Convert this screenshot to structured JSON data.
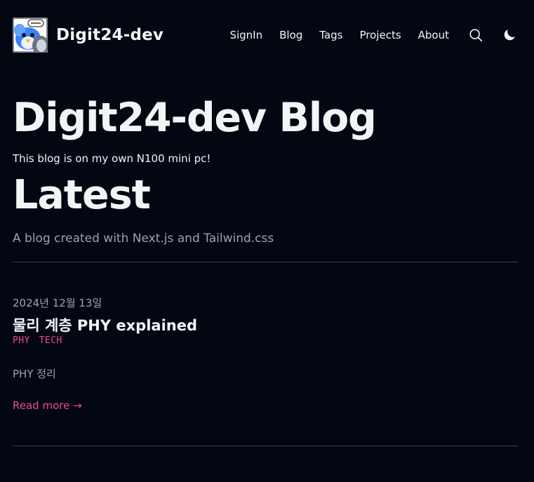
{
  "header": {
    "site_title": "Digit24-dev",
    "logo_icon": "penguin-mascot-logo",
    "nav": [
      {
        "label": "SignIn"
      },
      {
        "label": "Blog"
      },
      {
        "label": "Tags"
      },
      {
        "label": "Projects"
      },
      {
        "label": "About"
      }
    ],
    "search_icon": "search-icon",
    "theme_icon": "moon-icon"
  },
  "hero": {
    "title": "Digit24-dev Blog",
    "description": "This blog is on my own N100 mini pc!"
  },
  "latest": {
    "title": "Latest",
    "description": "A blog created with Next.js and Tailwind.css"
  },
  "posts": [
    {
      "date": "2024년 12월 13일",
      "title": "물리 계층 PHY explained",
      "tags": [
        "PHY",
        "TECH"
      ],
      "summary": "PHY 정리",
      "read_more": "Read more →"
    }
  ],
  "colors": {
    "background": "#030712",
    "text": "#f3f4f6",
    "muted": "#9ca3af",
    "accent": "#ec4899",
    "divider": "#374151"
  }
}
